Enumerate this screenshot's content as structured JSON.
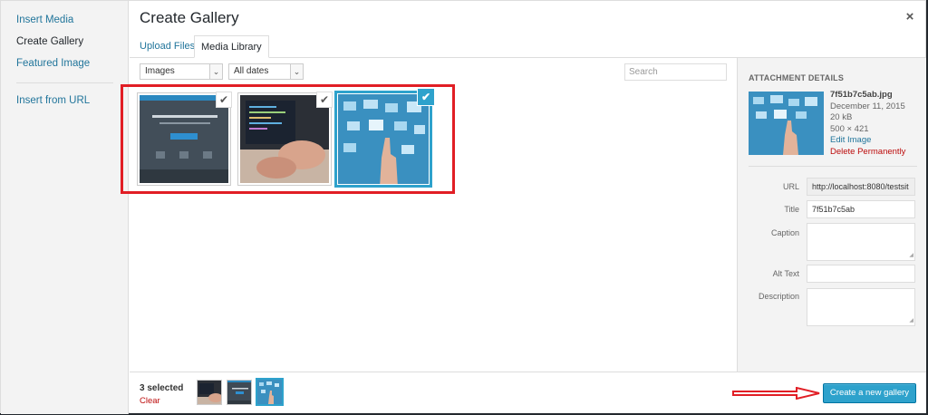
{
  "menu": {
    "insert_media": "Insert Media",
    "create_gallery": "Create Gallery",
    "featured_image": "Featured Image",
    "insert_from_url": "Insert from URL"
  },
  "header": {
    "title": "Create Gallery",
    "close": "×"
  },
  "tabs": {
    "upload": "Upload Files",
    "library": "Media Library"
  },
  "filters": {
    "type": "Images",
    "date": "All dates",
    "arrow": "⌄",
    "search_placeholder": "Search"
  },
  "attachments": [
    {
      "name": "website-screenshot",
      "checked": true
    },
    {
      "name": "laptop-photo",
      "checked": true
    },
    {
      "name": "touchscreen-hand",
      "checked": true,
      "selected": true
    }
  ],
  "check_glyph": "✔",
  "details": {
    "heading": "ATTACHMENT DETAILS",
    "filename": "7f51b7c5ab.jpg",
    "date": "December 11, 2015",
    "size": "20 kB",
    "dimensions": "500 × 421",
    "edit": "Edit Image",
    "delete": "Delete Permanently",
    "fields": {
      "url_label": "URL",
      "url_value": "http://localhost:8080/testsit",
      "title_label": "Title",
      "title_value": "7f51b7c5ab",
      "caption_label": "Caption",
      "caption_value": "",
      "alt_label": "Alt Text",
      "alt_value": "",
      "desc_label": "Description",
      "desc_value": ""
    }
  },
  "footer": {
    "selected": "3 selected",
    "clear": "Clear",
    "button": "Create a new gallery"
  },
  "colors": {
    "accent": "#2ea2cc",
    "highlight": "#e11e25",
    "link": "#21759b",
    "danger": "#bc0b0b"
  }
}
